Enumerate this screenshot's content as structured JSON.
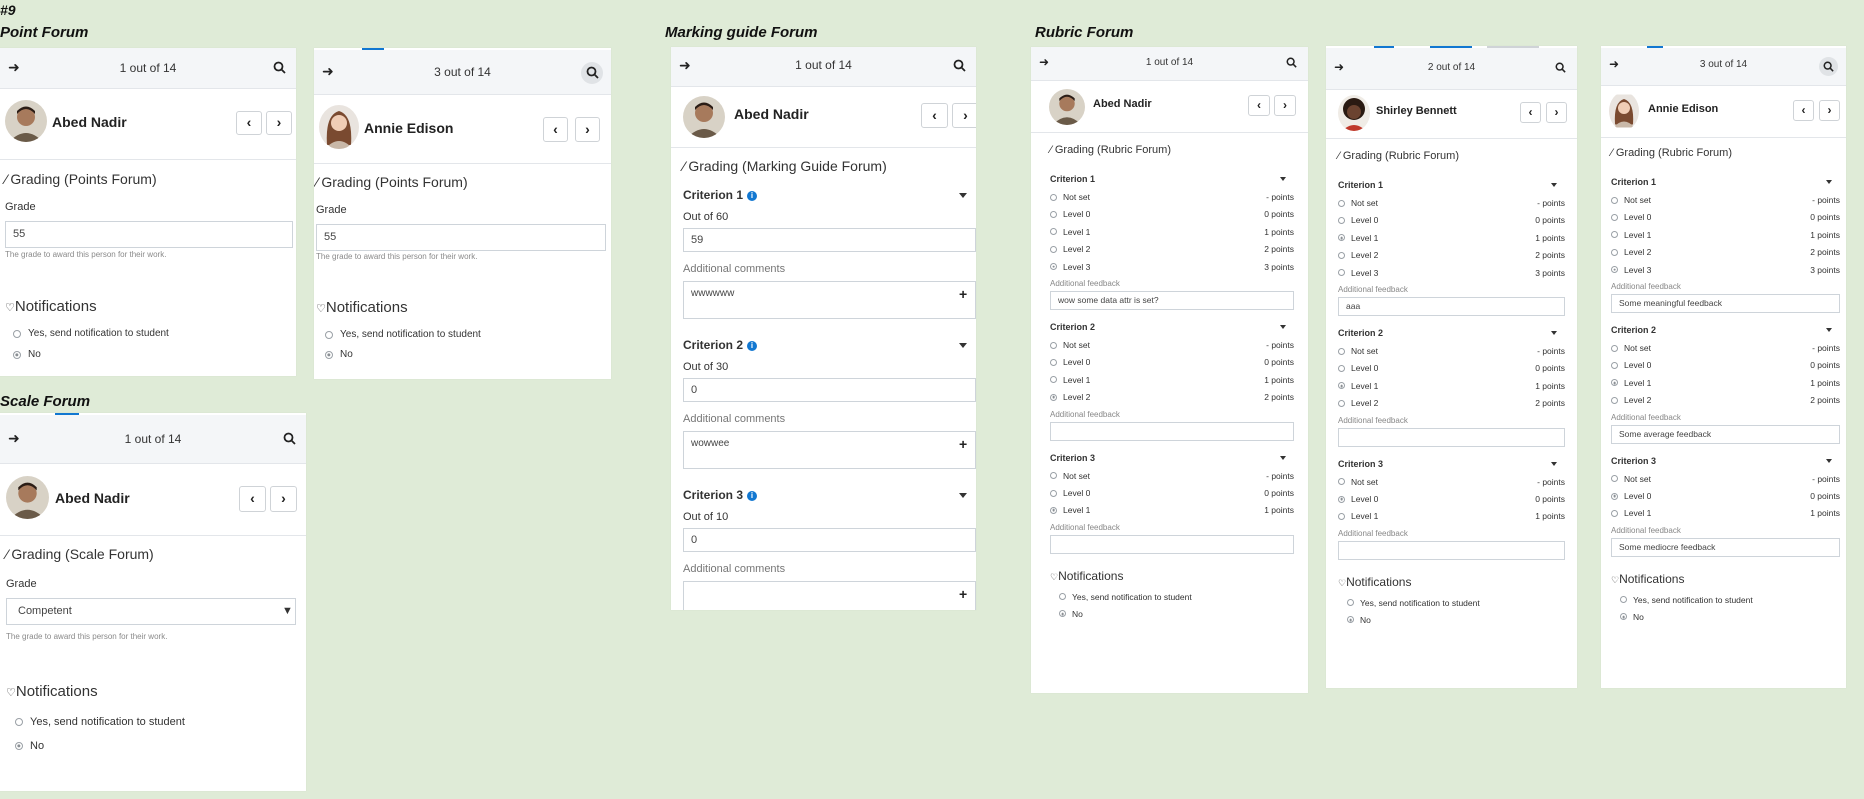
{
  "page_marker": "#9",
  "section_titles": {
    "point": "Point Forum",
    "marking": "Marking guide Forum",
    "rubric": "Rubric Forum",
    "scale": "Scale Forum"
  },
  "common": {
    "notifications": "Notifications",
    "notify_yes": "Yes, send notification to student",
    "notify_no": "No",
    "grade_label": "Grade",
    "grade_help": "The grade to award this person for their work.",
    "additional_feedback": "Additional feedback",
    "additional_comments": "Additional comments"
  },
  "point1": {
    "counter": "1 out of 14",
    "user": "Abed Nadir",
    "title": "Grading (Points Forum)",
    "grade": "55"
  },
  "point2": {
    "counter": "3 out of 14",
    "user": "Annie Edison",
    "title": "Grading (Points Forum)",
    "grade": "55"
  },
  "scale": {
    "counter": "1 out of 14",
    "user": "Abed Nadir",
    "title": "Grading (Scale Forum)",
    "grade": "Competent"
  },
  "marking": {
    "counter": "1 out of 14",
    "user": "Abed Nadir",
    "title": "Grading (Marking Guide Forum)",
    "criteria": [
      {
        "name": "Criterion 1",
        "outof": "Out of 60",
        "value": "59",
        "comment": "wwwwww"
      },
      {
        "name": "Criterion 2",
        "outof": "Out of 30",
        "value": "0",
        "comment": "wowwee"
      },
      {
        "name": "Criterion 3",
        "outof": "Out of 10",
        "value": "0",
        "comment": ""
      }
    ]
  },
  "rubric1": {
    "counter": "1 out of 14",
    "user": "Abed Nadir",
    "title": "Grading (Rubric Forum)",
    "criteria": [
      {
        "name": "Criterion 1",
        "feedback": "wow some data attr is set?",
        "levels": [
          {
            "label": "Not set",
            "points": "- points"
          },
          {
            "label": "Level 0",
            "points": "0 points"
          },
          {
            "label": "Level 1",
            "points": "1 points"
          },
          {
            "label": "Level 2",
            "points": "2 points"
          },
          {
            "label": "Level 3",
            "points": "3 points"
          }
        ],
        "selected": 4
      },
      {
        "name": "Criterion 2",
        "feedback": "",
        "levels": [
          {
            "label": "Not set",
            "points": "- points"
          },
          {
            "label": "Level 0",
            "points": "0 points"
          },
          {
            "label": "Level 1",
            "points": "1 points"
          },
          {
            "label": "Level 2",
            "points": "2 points"
          }
        ],
        "selected": 3
      },
      {
        "name": "Criterion 3",
        "feedback": "",
        "levels": [
          {
            "label": "Not set",
            "points": "- points"
          },
          {
            "label": "Level 0",
            "points": "0 points"
          },
          {
            "label": "Level 1",
            "points": "1 points"
          }
        ],
        "selected": 2
      }
    ]
  },
  "rubric2": {
    "counter": "2 out of 14",
    "user": "Shirley Bennett",
    "title": "Grading (Rubric Forum)",
    "criteria": [
      {
        "name": "Criterion 1",
        "feedback": "aaa",
        "levels": [
          {
            "label": "Not set",
            "points": "- points"
          },
          {
            "label": "Level 0",
            "points": "0 points"
          },
          {
            "label": "Level 1",
            "points": "1 points"
          },
          {
            "label": "Level 2",
            "points": "2 points"
          },
          {
            "label": "Level 3",
            "points": "3 points"
          }
        ],
        "selected": 2
      },
      {
        "name": "Criterion 2",
        "feedback": "",
        "levels": [
          {
            "label": "Not set",
            "points": "- points"
          },
          {
            "label": "Level 0",
            "points": "0 points"
          },
          {
            "label": "Level 1",
            "points": "1 points"
          },
          {
            "label": "Level 2",
            "points": "2 points"
          }
        ],
        "selected": 2
      },
      {
        "name": "Criterion 3",
        "feedback": "",
        "levels": [
          {
            "label": "Not set",
            "points": "- points"
          },
          {
            "label": "Level 0",
            "points": "0 points"
          },
          {
            "label": "Level 1",
            "points": "1 points"
          }
        ],
        "selected": 1
      }
    ]
  },
  "rubric3": {
    "counter": "3 out of 14",
    "user": "Annie Edison",
    "title": "Grading (Rubric Forum)",
    "criteria": [
      {
        "name": "Criterion 1",
        "feedback": "Some meaningful feedback",
        "levels": [
          {
            "label": "Not set",
            "points": "- points"
          },
          {
            "label": "Level 0",
            "points": "0 points"
          },
          {
            "label": "Level 1",
            "points": "1 points"
          },
          {
            "label": "Level 2",
            "points": "2 points"
          },
          {
            "label": "Level 3",
            "points": "3 points"
          }
        ],
        "selected": 4
      },
      {
        "name": "Criterion 2",
        "feedback": "Some average feedback",
        "levels": [
          {
            "label": "Not set",
            "points": "- points"
          },
          {
            "label": "Level 0",
            "points": "0 points"
          },
          {
            "label": "Level 1",
            "points": "1 points"
          },
          {
            "label": "Level 2",
            "points": "2 points"
          }
        ],
        "selected": 2
      },
      {
        "name": "Criterion 3",
        "feedback": "Some mediocre feedback",
        "levels": [
          {
            "label": "Not set",
            "points": "- points"
          },
          {
            "label": "Level 0",
            "points": "0 points"
          },
          {
            "label": "Level 1",
            "points": "1 points"
          }
        ],
        "selected": 1
      }
    ]
  }
}
